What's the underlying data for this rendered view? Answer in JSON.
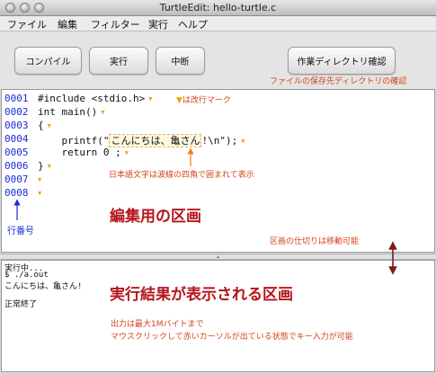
{
  "window": {
    "title": "TurtleEdit: hello-turtle.c"
  },
  "menu": [
    "ファイル",
    "編集",
    "フィルター",
    "実行",
    "ヘルプ"
  ],
  "toolbar": {
    "compile": "コンパイル",
    "run": "実行",
    "stop": "中断",
    "workdir": "作業ディレクトリ確認"
  },
  "annotations": {
    "workdir_note": "ファイルの保存先ディレクトリの確認",
    "newline_mark_note": "は改行マーク",
    "jp_box_note": "日本語文字は波線の四角で囲まれて表示",
    "editor_area": "編集用の区画",
    "line_numbers": "行番号",
    "split_note": "区画の仕切りは移動可能",
    "output_area": "実行結果が表示される区画",
    "output_max": "出力は最大1Mバイトまで",
    "output_input": "マウスクリックして赤いカーソルが出ている状態でキー入力が可能"
  },
  "editor": {
    "line_numbers": [
      "0001",
      "0002",
      "0003",
      "0004",
      "0005",
      "0006",
      "0007",
      "0008"
    ],
    "lines": [
      "#include <stdio.h>",
      "int main()",
      "{",
      "    printf(\"",
      "    return 0 ;",
      "}",
      "",
      ""
    ],
    "printf_jp": "こんにちは、亀さん",
    "printf_tail": "!\\n\");"
  },
  "output": {
    "lines": [
      "実行中...",
      "$ ./a.out",
      "こんにちは、亀さん!",
      "",
      "正常終了"
    ]
  },
  "colors": {
    "annotation": "#d2441c",
    "line_number": "#1a2bd6",
    "area_label": "#b5151b",
    "newline_mark": "#e8a317"
  }
}
